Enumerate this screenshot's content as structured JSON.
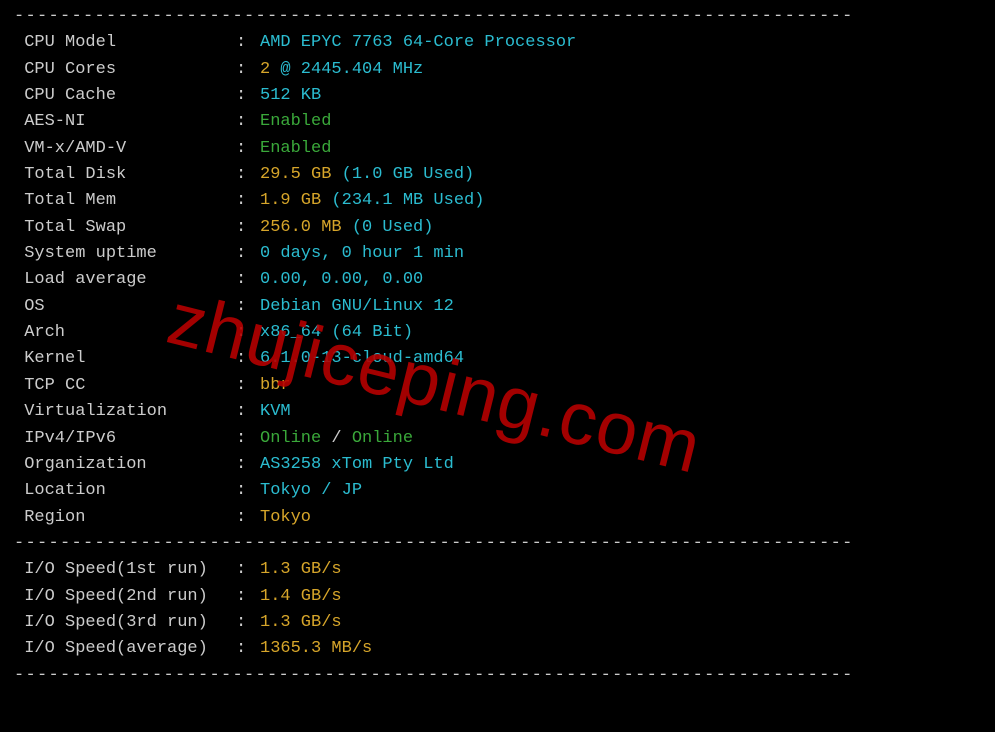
{
  "watermark": "zhujiceping.com",
  "rows": [
    {
      "label": "CPU Model",
      "parts": [
        {
          "cls": "cyan",
          "text": "AMD EPYC 7763 64-Core Processor"
        }
      ]
    },
    {
      "label": "CPU Cores",
      "parts": [
        {
          "cls": "yellow",
          "text": "2"
        },
        {
          "cls": "cyan",
          "text": " @ 2445.404 MHz"
        }
      ]
    },
    {
      "label": "CPU Cache",
      "parts": [
        {
          "cls": "cyan",
          "text": "512 KB"
        }
      ]
    },
    {
      "label": "AES-NI",
      "parts": [
        {
          "cls": "green",
          "text": "Enabled"
        }
      ]
    },
    {
      "label": "VM-x/AMD-V",
      "parts": [
        {
          "cls": "green",
          "text": "Enabled"
        }
      ]
    },
    {
      "label": "Total Disk",
      "parts": [
        {
          "cls": "yellow",
          "text": "29.5 GB"
        },
        {
          "cls": "cyan",
          "text": " (1.0 GB Used)"
        }
      ]
    },
    {
      "label": "Total Mem",
      "parts": [
        {
          "cls": "yellow",
          "text": "1.9 GB"
        },
        {
          "cls": "cyan",
          "text": " (234.1 MB Used)"
        }
      ]
    },
    {
      "label": "Total Swap",
      "parts": [
        {
          "cls": "yellow",
          "text": "256.0 MB"
        },
        {
          "cls": "cyan",
          "text": " (0 Used)"
        }
      ]
    },
    {
      "label": "System uptime",
      "parts": [
        {
          "cls": "cyan",
          "text": "0 days, 0 hour 1 min"
        }
      ]
    },
    {
      "label": "Load average",
      "parts": [
        {
          "cls": "cyan",
          "text": "0.00, 0.00, 0.00"
        }
      ]
    },
    {
      "label": "OS",
      "parts": [
        {
          "cls": "cyan",
          "text": "Debian GNU/Linux 12"
        }
      ]
    },
    {
      "label": "Arch",
      "parts": [
        {
          "cls": "cyan",
          "text": "x86_64 (64 Bit)"
        }
      ]
    },
    {
      "label": "Kernel",
      "parts": [
        {
          "cls": "cyan",
          "text": "6.1.0-13-cloud-amd64"
        }
      ]
    },
    {
      "label": "TCP CC",
      "parts": [
        {
          "cls": "yellow",
          "text": "bbr"
        }
      ]
    },
    {
      "label": "Virtualization",
      "parts": [
        {
          "cls": "cyan",
          "text": "KVM"
        }
      ]
    },
    {
      "label": "IPv4/IPv6",
      "parts": [
        {
          "cls": "green",
          "text": "Online"
        },
        {
          "cls": "white",
          "text": " / "
        },
        {
          "cls": "green",
          "text": "Online"
        }
      ]
    },
    {
      "label": "Organization",
      "parts": [
        {
          "cls": "cyan",
          "text": "AS3258 xTom Pty Ltd"
        }
      ]
    },
    {
      "label": "Location",
      "parts": [
        {
          "cls": "cyan",
          "text": "Tokyo / JP"
        }
      ]
    },
    {
      "label": "Region",
      "parts": [
        {
          "cls": "yellow",
          "text": "Tokyo"
        }
      ]
    }
  ],
  "io_rows": [
    {
      "label": "I/O Speed(1st run)",
      "parts": [
        {
          "cls": "yellow",
          "text": "1.3 GB/s"
        }
      ]
    },
    {
      "label": "I/O Speed(2nd run)",
      "parts": [
        {
          "cls": "yellow",
          "text": "1.4 GB/s"
        }
      ]
    },
    {
      "label": "I/O Speed(3rd run)",
      "parts": [
        {
          "cls": "yellow",
          "text": "1.3 GB/s"
        }
      ]
    },
    {
      "label": "I/O Speed(average)",
      "parts": [
        {
          "cls": "yellow",
          "text": "1365.3 MB/s"
        }
      ]
    }
  ],
  "dash_line": "-------------------------------------------------------------------------"
}
